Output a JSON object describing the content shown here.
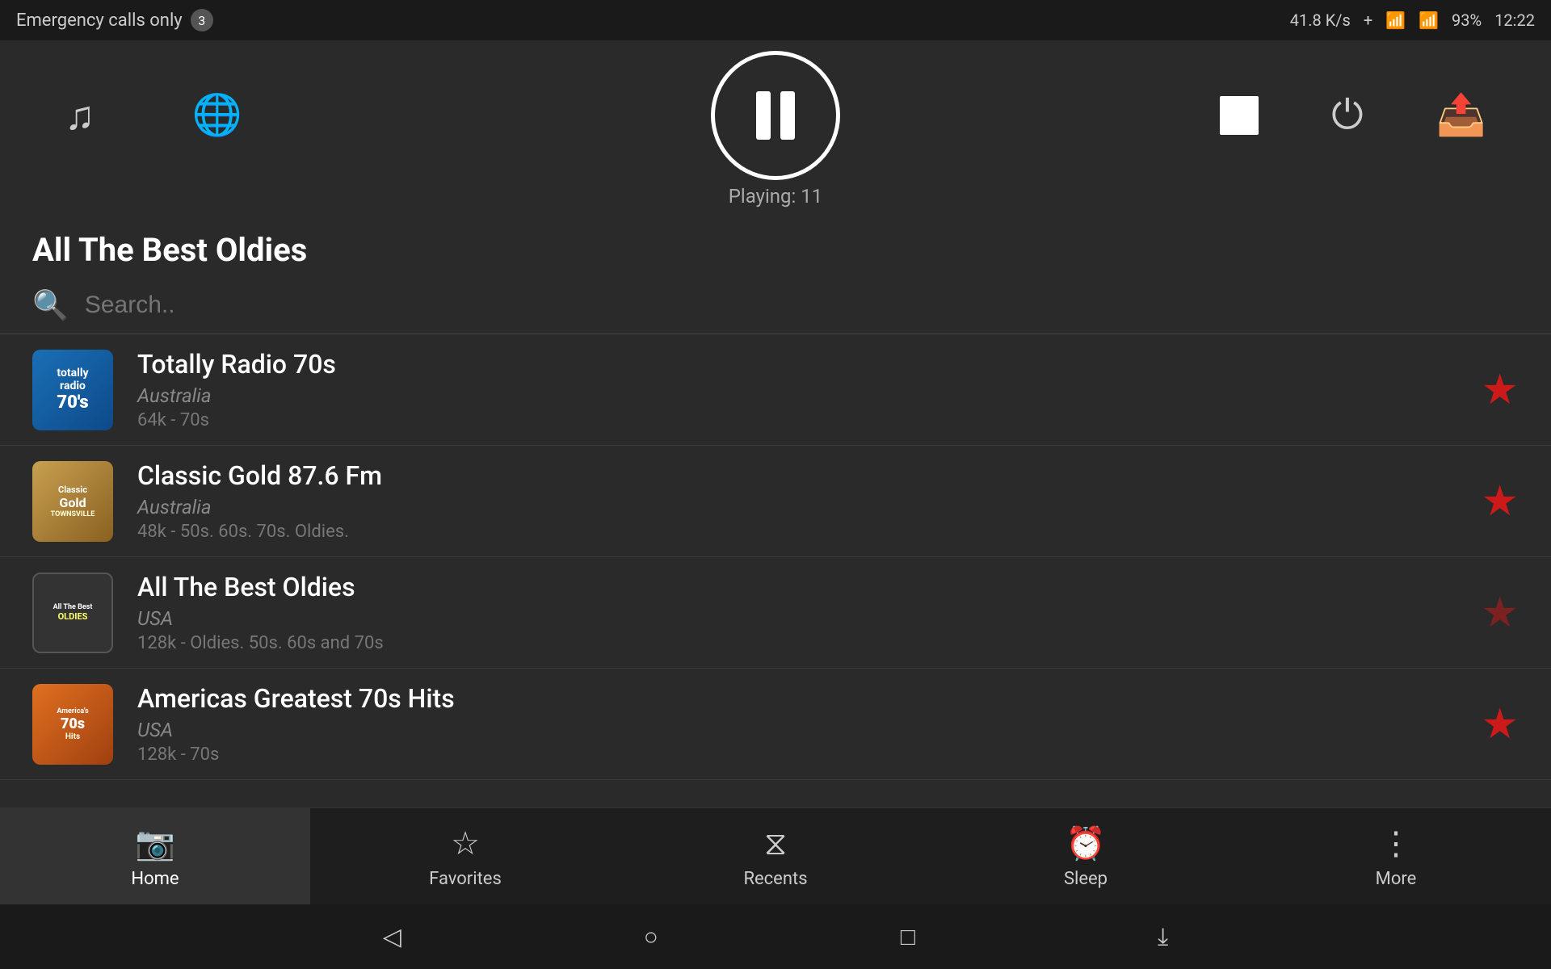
{
  "statusBar": {
    "emergencyText": "Emergency calls only",
    "badge": "3",
    "speed": "41.8 K/s",
    "battery": "93%",
    "time": "12:22"
  },
  "player": {
    "nowPlayingLabel": "Playing: 11",
    "pauseLabel": "pause"
  },
  "pageTitle": "All The Best Oldies",
  "search": {
    "placeholder": "Search.."
  },
  "stations": [
    {
      "name": "Totally Radio 70s",
      "country": "Australia",
      "meta": "64k - 70s",
      "favorited": true,
      "thumbType": "70s"
    },
    {
      "name": "Classic Gold 87.6 Fm",
      "country": "Australia",
      "meta": "48k - 50s. 60s. 70s. Oldies.",
      "favorited": true,
      "thumbType": "classic"
    },
    {
      "name": "All The Best Oldies",
      "country": "USA",
      "meta": "128k - Oldies. 50s. 60s and 70s",
      "favorited": false,
      "thumbType": "oldies"
    },
    {
      "name": "Americas Greatest 70s Hits",
      "country": "USA",
      "meta": "128k - 70s",
      "favorited": true,
      "thumbType": "americas"
    }
  ],
  "bottomNav": [
    {
      "id": "home",
      "label": "Home",
      "active": true
    },
    {
      "id": "favorites",
      "label": "Favorites",
      "active": false
    },
    {
      "id": "recents",
      "label": "Recents",
      "active": false
    },
    {
      "id": "sleep",
      "label": "Sleep",
      "active": false
    },
    {
      "id": "more",
      "label": "More",
      "active": false
    }
  ]
}
